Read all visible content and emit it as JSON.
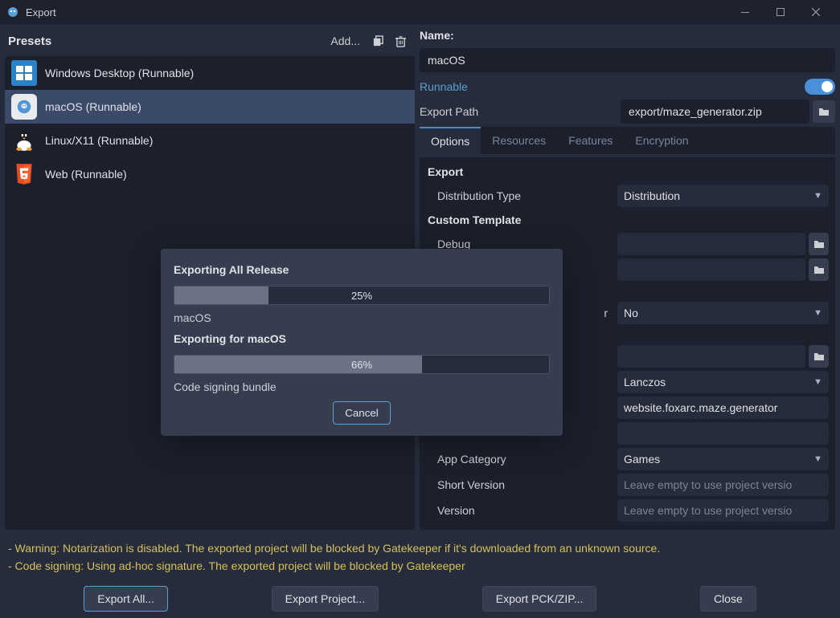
{
  "window": {
    "title": "Export"
  },
  "presets": {
    "label": "Presets",
    "add_label": "Add...",
    "items": [
      {
        "label": "Windows Desktop (Runnable)",
        "icon_key": "windows"
      },
      {
        "label": "macOS (Runnable)",
        "icon_key": "macos"
      },
      {
        "label": "Linux/X11 (Runnable)",
        "icon_key": "linux"
      },
      {
        "label": "Web (Runnable)",
        "icon_key": "html5"
      }
    ],
    "selected_index": 1
  },
  "name": {
    "label": "Name:",
    "value": "macOS"
  },
  "runnable": {
    "label": "Runnable",
    "value": true
  },
  "export_path": {
    "label": "Export Path",
    "value": "export/maze_generator.zip"
  },
  "tabs": {
    "items": [
      "Options",
      "Resources",
      "Features",
      "Encryption"
    ],
    "active_index": 0
  },
  "options": {
    "export_section": "Export",
    "distribution_type": {
      "label": "Distribution Type",
      "value": "Distribution"
    },
    "custom_template_section": "Custom Template",
    "debug": {
      "label": "Debug",
      "value": ""
    },
    "release_row_value": "",
    "row_dropdown_value": "No",
    "row_lanczos": "Lanczos",
    "bundle_id": "website.foxarc.maze.generator",
    "app_category": {
      "label": "App Category",
      "value": "Games"
    },
    "short_version": {
      "label": "Short Version",
      "placeholder": "Leave empty to use project versio"
    },
    "version": {
      "label": "Version",
      "placeholder": "Leave empty to use project versio"
    }
  },
  "warnings": [
    "- Warning: Notarization is disabled. The exported project will be blocked by Gatekeeper if it's downloaded from an unknown source.",
    "- Code signing: Using ad-hoc signature. The exported project will be blocked by Gatekeeper"
  ],
  "footer": {
    "export_all": "Export All...",
    "export_project": "Export Project...",
    "export_pck": "Export PCK/ZIP...",
    "close": "Close"
  },
  "modal": {
    "title1": "Exporting All Release",
    "progress1": 25,
    "progress1_label": "25%",
    "sub1": "macOS",
    "title2": "Exporting for macOS",
    "progress2": 66,
    "progress2_label": "66%",
    "sub2": "Code signing bundle",
    "cancel": "Cancel"
  }
}
